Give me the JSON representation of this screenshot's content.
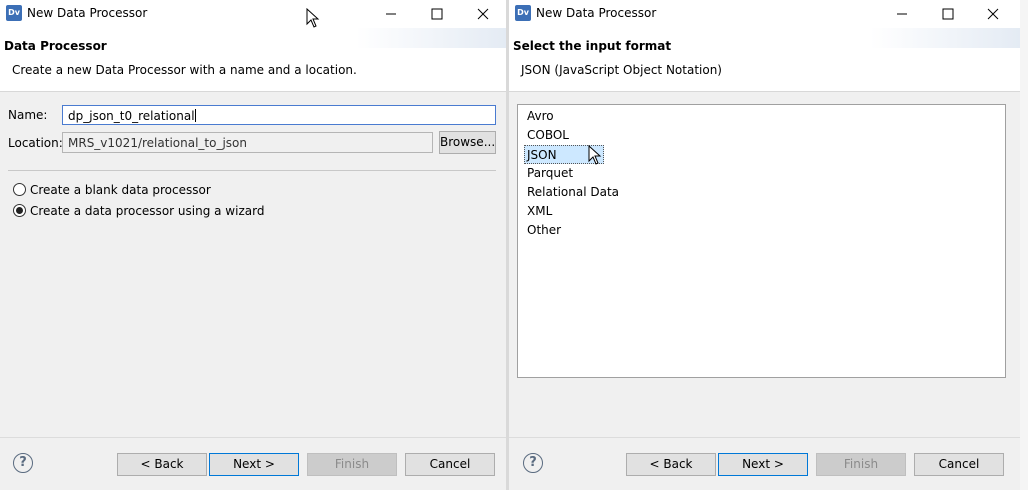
{
  "dialogs": [
    {
      "title": "New Data Processor",
      "app_icon": "Dv",
      "header": {
        "title": "Data Processor",
        "description": "Create a new Data Processor with a name and a location."
      },
      "name_label": "Name:",
      "name_value": "dp_json_t0_relational",
      "location_label": "Location:",
      "location_value": "MRS_v1021/relational_to_json",
      "browse_label": "Browse...",
      "options": [
        {
          "label": "Create a blank data processor",
          "selected": false
        },
        {
          "label": "Create a data processor using a wizard",
          "selected": true
        }
      ],
      "buttons": {
        "back": "< Back",
        "next": "Next >",
        "finish": "Finish",
        "cancel": "Cancel"
      }
    },
    {
      "title": "New Data Processor",
      "app_icon": "Dv",
      "header": {
        "title": "Select the input format",
        "description": "JSON (JavaScript Object Notation)"
      },
      "formats": [
        "Avro",
        "COBOL",
        "JSON",
        "Parquet",
        "Relational Data",
        "XML",
        "Other"
      ],
      "selected_format": "JSON",
      "buttons": {
        "back": "< Back",
        "next": "Next >",
        "finish": "Finish",
        "cancel": "Cancel"
      }
    }
  ],
  "icons": {
    "help": "question-mark",
    "minimize": "minimize-icon",
    "maximize": "maximize-icon",
    "close": "close-icon",
    "cursor": "mouse-pointer"
  },
  "colors": {
    "dialog_bg": "#f0f0f0",
    "selection": "#cde8ff",
    "focus_border": "#0078d7"
  }
}
